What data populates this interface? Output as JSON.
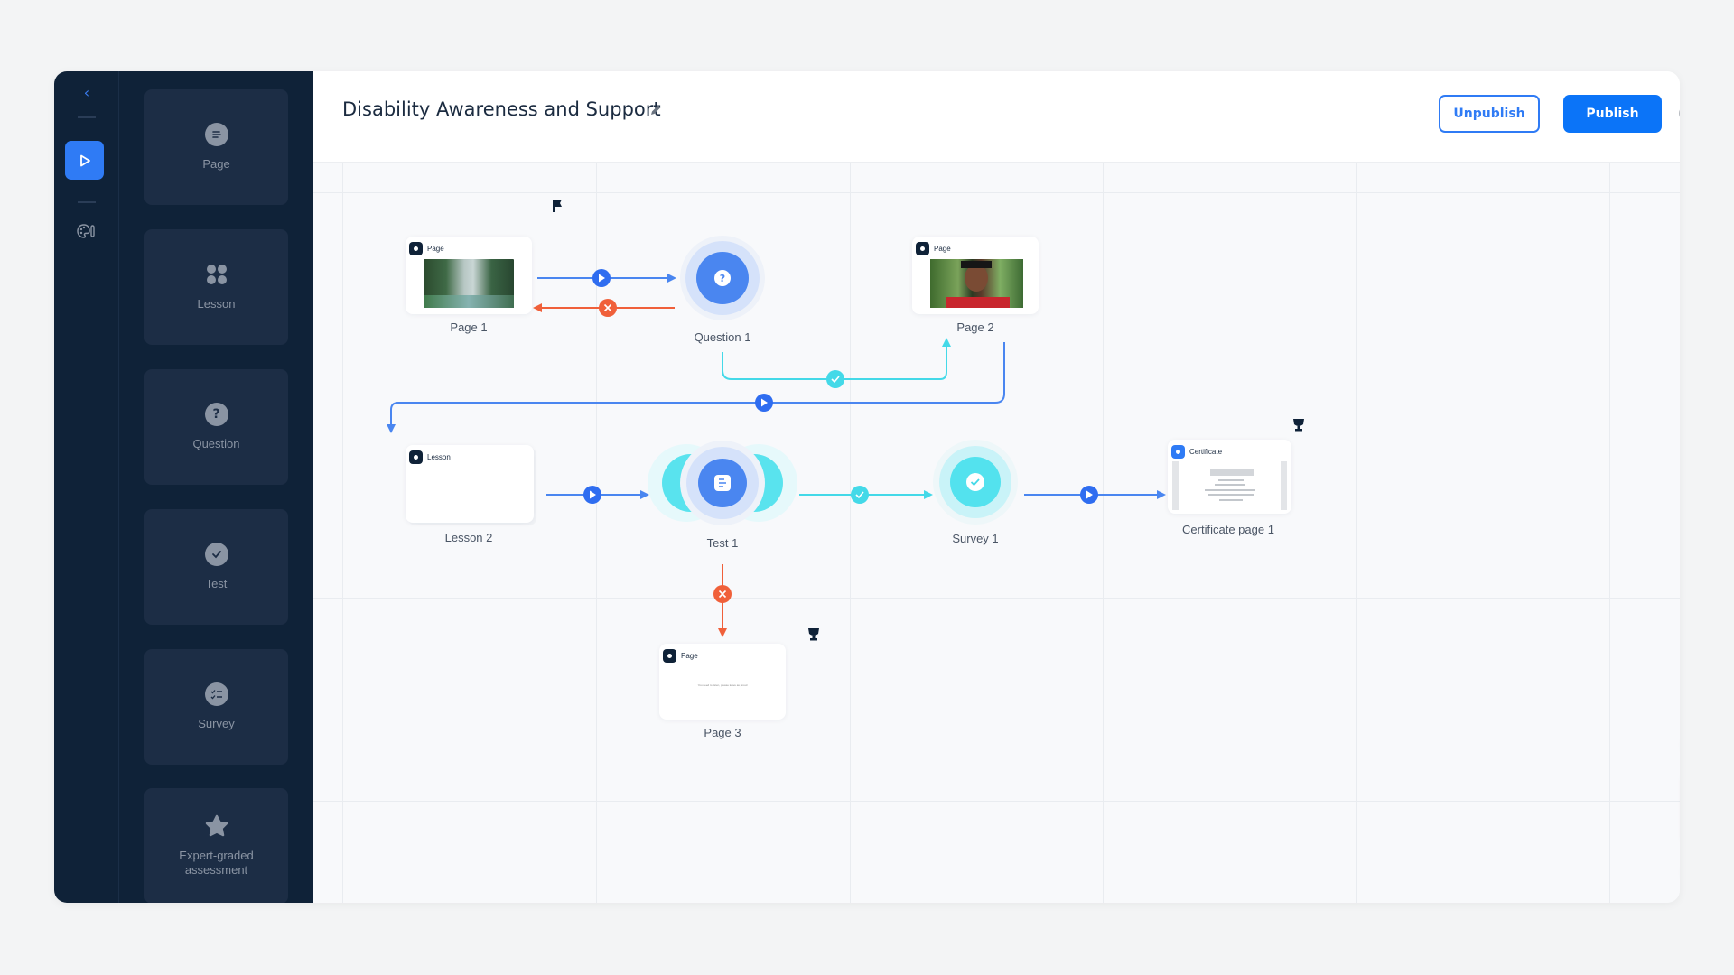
{
  "rail": {
    "back_icon": "chevron-left-icon",
    "play_icon": "play-icon",
    "palette_icon": "palette-icon"
  },
  "palette": {
    "items": [
      {
        "label": "Page",
        "icon": "page-icon"
      },
      {
        "label": "Lesson",
        "icon": "grid-icon"
      },
      {
        "label": "Question",
        "icon": "question-icon"
      },
      {
        "label": "Test",
        "icon": "check-icon"
      },
      {
        "label": "Survey",
        "icon": "checklist-icon"
      },
      {
        "label": "Expert-graded assessment",
        "icon": "star-icon"
      }
    ]
  },
  "header": {
    "title": "Disability Awareness and Support",
    "unpublish_label": "Unpublish",
    "publish_label": "Publish",
    "info_icon": "info-icon"
  },
  "flow": {
    "nodes": [
      {
        "id": "page1",
        "type": "Page",
        "label": "Page 1",
        "start_flag": true
      },
      {
        "id": "question1",
        "type": "Question",
        "label": "Question 1"
      },
      {
        "id": "page2",
        "type": "Page",
        "label": "Page 2"
      },
      {
        "id": "lesson2",
        "type": "Lesson",
        "label": "Lesson 2"
      },
      {
        "id": "test1",
        "type": "Test",
        "label": "Test 1"
      },
      {
        "id": "survey1",
        "type": "Survey",
        "label": "Survey 1"
      },
      {
        "id": "cert1",
        "type": "Certificate",
        "label": "Certificate page 1",
        "trophy": true
      },
      {
        "id": "page3",
        "type": "Page",
        "label": "Page 3",
        "trophy": true,
        "preview_text": "You need to listen, please leave as proud"
      }
    ],
    "edges": [
      {
        "from": "page1",
        "to": "question1",
        "kind": "next"
      },
      {
        "from": "question1",
        "to": "page1",
        "kind": "fail"
      },
      {
        "from": "question1",
        "to": "page2",
        "kind": "pass"
      },
      {
        "from": "page2",
        "to": "lesson2",
        "kind": "next"
      },
      {
        "from": "lesson2",
        "to": "test1",
        "kind": "next"
      },
      {
        "from": "test1",
        "to": "survey1",
        "kind": "pass"
      },
      {
        "from": "survey1",
        "to": "cert1",
        "kind": "next"
      },
      {
        "from": "test1",
        "to": "page3",
        "kind": "fail"
      }
    ]
  },
  "controls": {
    "flag_icon": "flag-icon",
    "zoom_in": "+",
    "zoom_out": "−",
    "trophy_icon": "trophy-icon"
  },
  "colors": {
    "brand": "#0b74f8",
    "next": "#4a86f0",
    "fail": "#f0603a",
    "pass": "#44d9e8",
    "dark": "#0f2238"
  }
}
